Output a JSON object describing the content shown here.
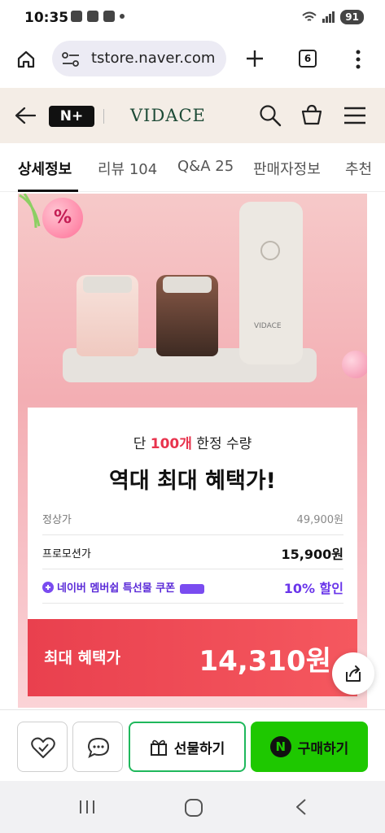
{
  "status_bar": {
    "time": "10:35",
    "battery": "91"
  },
  "browser": {
    "url": "tstore.naver.com",
    "tab_count": "6"
  },
  "store_header": {
    "badge": "N+",
    "brand": "VIDACE"
  },
  "tabs": [
    {
      "label": "상세정보"
    },
    {
      "label": "리뷰 104"
    },
    {
      "label": "Q&A 25"
    },
    {
      "label": "판매자정보"
    },
    {
      "label": "추천"
    }
  ],
  "promo": {
    "badge_symbol": "%",
    "grinder_label": "VIDACE",
    "headline_prefix": "단 ",
    "headline_highlight": "100개",
    "headline_suffix": " 한정 수량",
    "title": "역대 최대 혜택가!",
    "rows": [
      {
        "label": "정상가",
        "value": "49,900원"
      },
      {
        "label": "프로모션가",
        "value": "15,900원"
      },
      {
        "label": "네이버 멤버쉽 특선물 쿠폰",
        "value": "10% 할인"
      }
    ],
    "benefit_label": "최대 혜택가",
    "benefit_price": "14,310원"
  },
  "action_bar": {
    "gift_label": "선물하기",
    "buy_label": "구매하기",
    "buy_badge": "N"
  },
  "colors": {
    "accent_green": "#1ec800",
    "benefit_red": "#e9404e",
    "coupon_purple": "#7a4cf0",
    "header_bg": "#f4ede6"
  }
}
